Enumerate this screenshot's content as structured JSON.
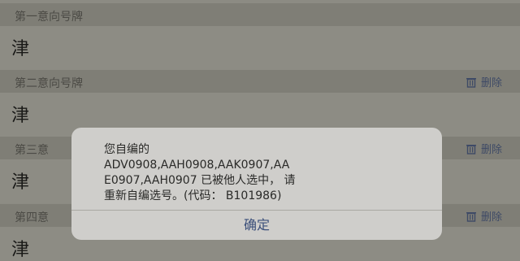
{
  "sections": [
    {
      "label": "第一意向号牌",
      "prefix": "津",
      "delete_label": ""
    },
    {
      "label": "第二意向号牌",
      "prefix": "津",
      "delete_label": "删除"
    },
    {
      "label": "第三意",
      "prefix": "津",
      "delete_label": "删除"
    },
    {
      "label": "第四意",
      "prefix": "津",
      "delete_label": "删除"
    }
  ],
  "dialog": {
    "message": "您自编的\nADV0908,AAH0908,AAK0907,AA\nE0907,AAH0907 已被他人选中， 请\n重新自编选号。(代码： B101986)",
    "confirm_label": "确定"
  },
  "icons": {
    "delete": "trash-icon"
  },
  "colors": {
    "overlay_background": "#8c8b83",
    "dialog_background": "#cfcecb",
    "link_blue": "#3b4f7a"
  }
}
